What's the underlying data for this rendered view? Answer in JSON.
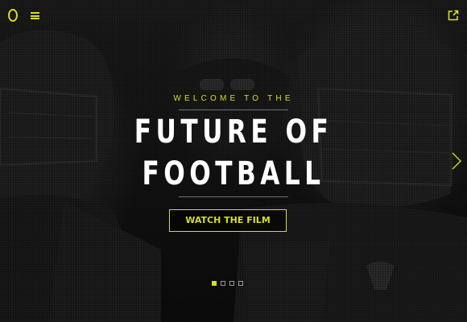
{
  "colors": {
    "accent": "#d7de21",
    "background": "#111111",
    "title_text": "#ffffff"
  },
  "header": {
    "logo_icon": "oregon-o-logo-icon",
    "menu_icon": "hamburger-menu-icon",
    "share_icon": "share-icon"
  },
  "hero": {
    "kicker": "WELCOME TO THE",
    "title_line1": "FUTURE OF",
    "title_line2": "FOOTBALL",
    "cta_label": "WATCH THE FILM"
  },
  "slider": {
    "next_icon": "chevron-right-icon",
    "slide_count": 4,
    "active_slide": 1
  }
}
